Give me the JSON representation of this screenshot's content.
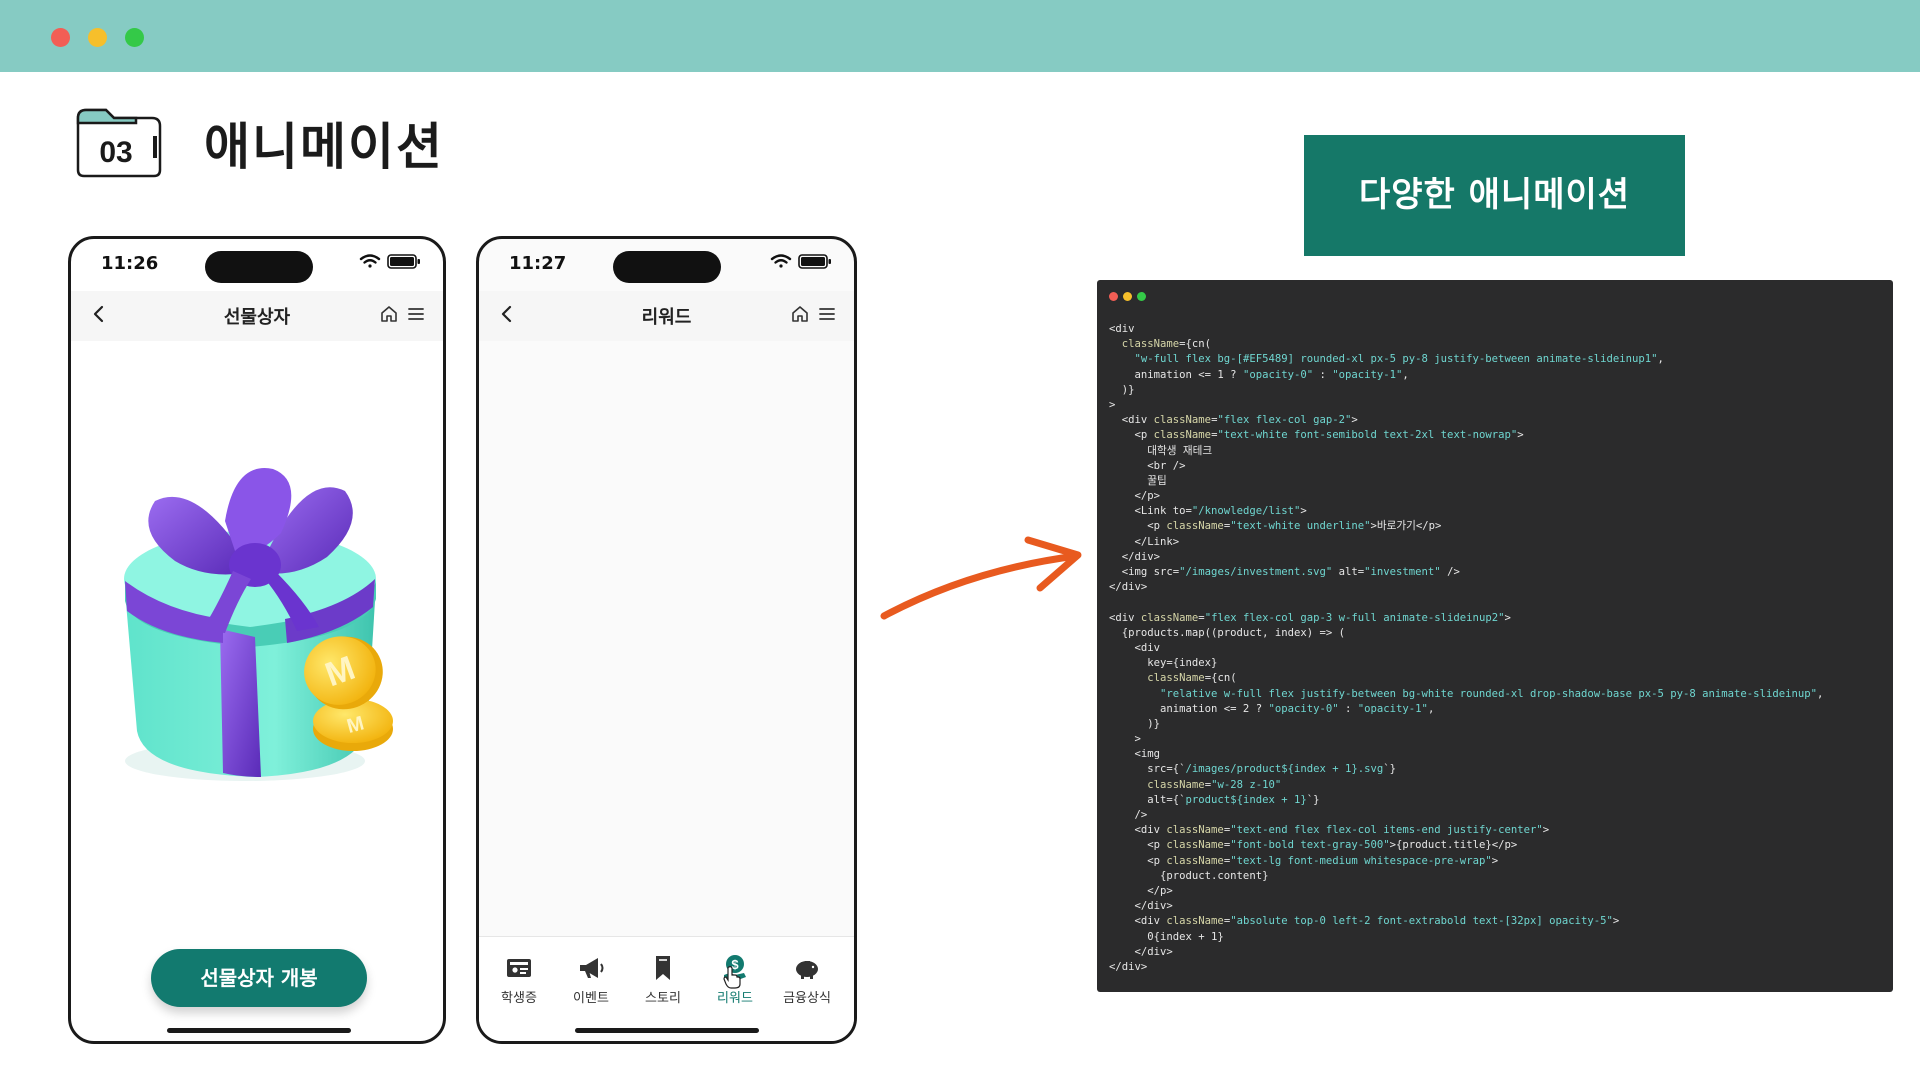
{
  "window": {
    "lights": [
      "red",
      "yellow",
      "green"
    ],
    "colors": {
      "bar": "#86cbc3",
      "red": "#f25e55",
      "yellow": "#f6bf2b",
      "green": "#34c948"
    }
  },
  "section": {
    "number": "03",
    "title": "애니메이션"
  },
  "phone_left": {
    "time": "11:26",
    "title": "선물상자",
    "button_label": "선물상자 개봉",
    "accent_color": "#127a6f"
  },
  "phone_right": {
    "time": "11:27",
    "title": "리워드",
    "tabs": [
      {
        "label": "학생증",
        "icon": "id-card-icon",
        "active": false
      },
      {
        "label": "이벤트",
        "icon": "megaphone-icon",
        "active": false
      },
      {
        "label": "스토리",
        "icon": "bookmark-icon",
        "active": false
      },
      {
        "label": "리워드",
        "icon": "reward-coin-icon",
        "active": true
      },
      {
        "label": "금융상식",
        "icon": "piggy-bank-icon",
        "active": false
      }
    ]
  },
  "headline": {
    "text": "다양한 애니메이션",
    "bg_color": "#157868"
  },
  "code": {
    "lines": [
      [
        [
          "t",
          "<div"
        ]
      ],
      [
        [
          "t",
          "  "
        ],
        [
          "a",
          "className"
        ],
        [
          "t",
          "={cn("
        ]
      ],
      [
        [
          "t",
          "    "
        ],
        [
          "s",
          "\"w-full flex bg-[#EF5489] rounded-xl px-5 py-8 justify-between animate-slideinup1\""
        ],
        [
          "t",
          ","
        ]
      ],
      [
        [
          "t",
          "    animation <= 1 ? "
        ],
        [
          "s",
          "\"opacity-0\""
        ],
        [
          "t",
          " : "
        ],
        [
          "s",
          "\"opacity-1\""
        ],
        [
          "t",
          ","
        ]
      ],
      [
        [
          "t",
          "  )}"
        ]
      ],
      [
        [
          "t",
          ">"
        ]
      ],
      [
        [
          "t",
          "  <div "
        ],
        [
          "a",
          "className"
        ],
        [
          "t",
          "="
        ],
        [
          "s",
          "\"flex flex-col gap-2\""
        ],
        [
          "t",
          ">"
        ]
      ],
      [
        [
          "t",
          "    <p "
        ],
        [
          "a",
          "className"
        ],
        [
          "t",
          "="
        ],
        [
          "s",
          "\"text-white font-semibold text-2xl text-nowrap\""
        ],
        [
          "t",
          ">"
        ]
      ],
      [
        [
          "t",
          "      대학생 재테크"
        ]
      ],
      [
        [
          "t",
          "      <br />"
        ]
      ],
      [
        [
          "t",
          "      꿀팁"
        ]
      ],
      [
        [
          "t",
          "    </p>"
        ]
      ],
      [
        [
          "t",
          "    <Link to="
        ],
        [
          "s",
          "\"/knowledge/list\""
        ],
        [
          "t",
          ">"
        ]
      ],
      [
        [
          "t",
          "      <p "
        ],
        [
          "a",
          "className"
        ],
        [
          "t",
          "="
        ],
        [
          "s",
          "\"text-white underline\""
        ],
        [
          "t",
          ">바로가기</p>"
        ]
      ],
      [
        [
          "t",
          "    </Link>"
        ]
      ],
      [
        [
          "t",
          "  </div>"
        ]
      ],
      [
        [
          "t",
          "  <img src="
        ],
        [
          "s",
          "\"/images/investment.svg\""
        ],
        [
          "t",
          " alt="
        ],
        [
          "s",
          "\"investment\""
        ],
        [
          "t",
          " />"
        ]
      ],
      [
        [
          "t",
          "</div>"
        ]
      ],
      [
        [
          "t",
          ""
        ]
      ],
      [
        [
          "t",
          "<div "
        ],
        [
          "a",
          "className"
        ],
        [
          "t",
          "="
        ],
        [
          "s",
          "\"flex flex-col gap-3 w-full animate-slideinup2\""
        ],
        [
          "t",
          ">"
        ]
      ],
      [
        [
          "t",
          "  {products.map((product, index) => ("
        ]
      ],
      [
        [
          "t",
          "    <div"
        ]
      ],
      [
        [
          "t",
          "      key={index}"
        ]
      ],
      [
        [
          "t",
          "      "
        ],
        [
          "a",
          "className"
        ],
        [
          "t",
          "={cn("
        ]
      ],
      [
        [
          "t",
          "        "
        ],
        [
          "s",
          "\"relative w-full flex justify-between bg-white rounded-xl drop-shadow-base px-5 py-8 animate-slideinup\""
        ],
        [
          "t",
          ","
        ]
      ],
      [
        [
          "t",
          "        animation <= 2 ? "
        ],
        [
          "s",
          "\"opacity-0\""
        ],
        [
          "t",
          " : "
        ],
        [
          "s",
          "\"opacity-1\""
        ],
        [
          "t",
          ","
        ]
      ],
      [
        [
          "t",
          "      )}"
        ]
      ],
      [
        [
          "t",
          "    >"
        ]
      ],
      [
        [
          "t",
          "    <img"
        ]
      ],
      [
        [
          "t",
          "      src={`"
        ],
        [
          "s",
          "/images/product${index + 1}.svg"
        ],
        [
          "t",
          "`}"
        ]
      ],
      [
        [
          "t",
          "      "
        ],
        [
          "a",
          "className"
        ],
        [
          "t",
          "="
        ],
        [
          "s",
          "\"w-28 z-10\""
        ]
      ],
      [
        [
          "t",
          "      alt={`"
        ],
        [
          "s",
          "product${index + 1}"
        ],
        [
          "t",
          "`}"
        ]
      ],
      [
        [
          "t",
          "    />"
        ]
      ],
      [
        [
          "t",
          "    <div "
        ],
        [
          "a",
          "className"
        ],
        [
          "t",
          "="
        ],
        [
          "s",
          "\"text-end flex flex-col items-end justify-center\""
        ],
        [
          "t",
          ">"
        ]
      ],
      [
        [
          "t",
          "      <p "
        ],
        [
          "a",
          "className"
        ],
        [
          "t",
          "="
        ],
        [
          "s",
          "\"font-bold text-gray-500\""
        ],
        [
          "t",
          ">{product.title}</p>"
        ]
      ],
      [
        [
          "t",
          "      <p "
        ],
        [
          "a",
          "className"
        ],
        [
          "t",
          "="
        ],
        [
          "s",
          "\"text-lg font-medium whitespace-pre-wrap\""
        ],
        [
          "t",
          ">"
        ]
      ],
      [
        [
          "t",
          "        {product.content}"
        ]
      ],
      [
        [
          "t",
          "      </p>"
        ]
      ],
      [
        [
          "t",
          "    </div>"
        ]
      ],
      [
        [
          "t",
          "    <div "
        ],
        [
          "a",
          "className"
        ],
        [
          "t",
          "="
        ],
        [
          "s",
          "\"absolute top-0 left-2 font-extrabold text-[32px] opacity-5\""
        ],
        [
          "t",
          ">"
        ]
      ],
      [
        [
          "t",
          "      0{index + 1}"
        ]
      ],
      [
        [
          "t",
          "    </div>"
        ]
      ],
      [
        [
          "t",
          "</div>"
        ]
      ]
    ],
    "colors": {
      "t": "#e6e6e6",
      "a": "#d6d6a8",
      "s": "#6fd6d0",
      "bg": "#2b2b2c"
    }
  }
}
